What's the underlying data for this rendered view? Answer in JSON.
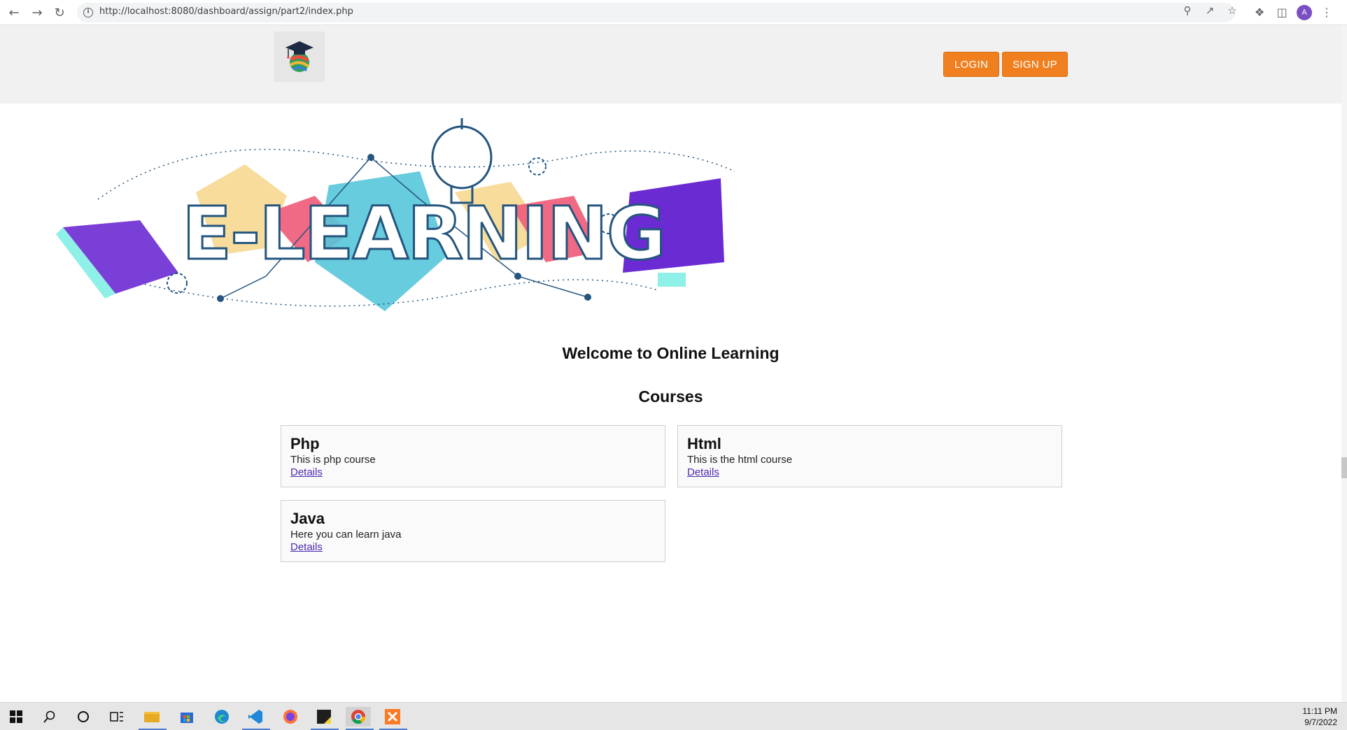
{
  "browser": {
    "url": "http://localhost:8080/dashboard/assign/part2/index.php",
    "profile_initial": "A"
  },
  "header": {
    "login_label": "LOGIN",
    "signup_label": "SIGN UP"
  },
  "banner": {
    "text": "E-LEARNING"
  },
  "main": {
    "welcome": "Welcome to Online Learning",
    "courses_heading": "Courses",
    "courses": [
      {
        "title": "Php",
        "description": "This is php course",
        "link": "Details"
      },
      {
        "title": "Html",
        "description": "This is the html course",
        "link": "Details"
      },
      {
        "title": "Java",
        "description": "Here you can learn java",
        "link": "Details"
      }
    ]
  },
  "taskbar": {
    "time": "11:11 PM",
    "date": "9/7/2022"
  },
  "colors": {
    "accent": "#f0801f",
    "header_bg": "#f1f1f1",
    "link": "#4b2ab0"
  }
}
